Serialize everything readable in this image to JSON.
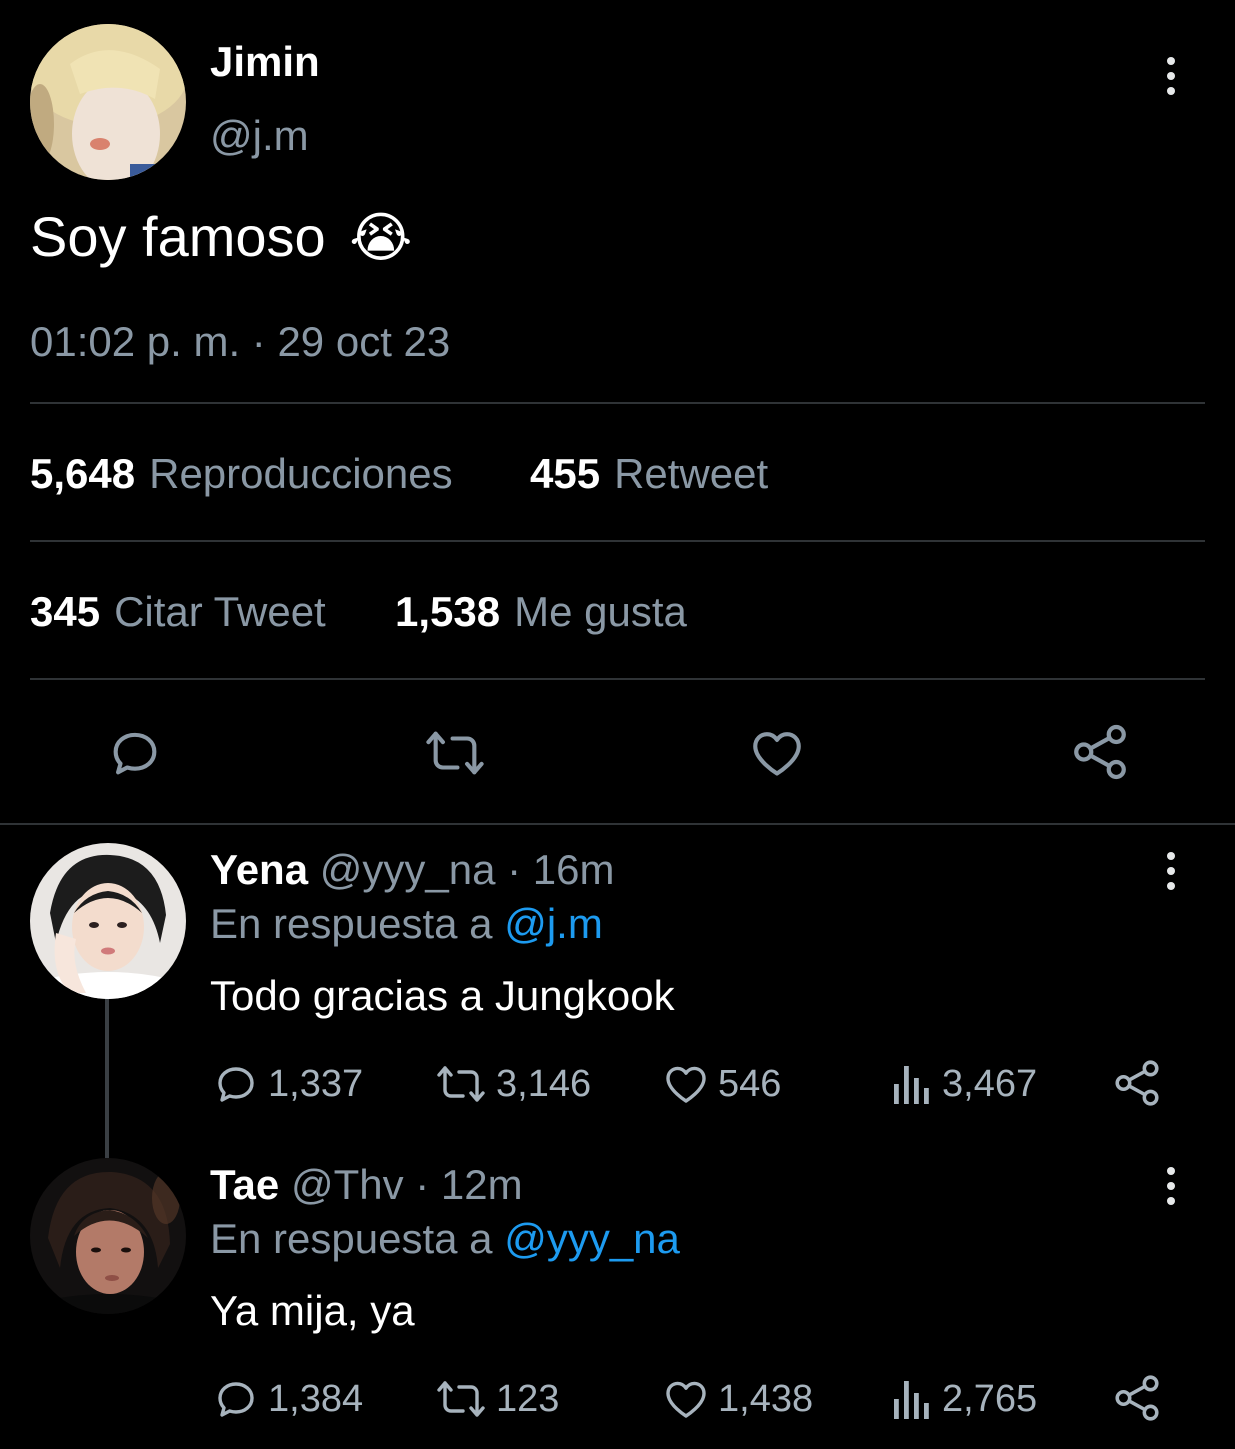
{
  "tweet": {
    "author_name": "Jimin",
    "author_handle": "@j.m",
    "text": "Soy famoso",
    "emoji": "😭",
    "timestamp": "01:02 p. m. · 29 oct 23",
    "stats": {
      "views_count": "5,648",
      "views_label": "Reproducciones",
      "retweets_count": "455",
      "retweets_label": "Retweet",
      "quotes_count": "345",
      "quotes_label": "Citar Tweet",
      "likes_count": "1,538",
      "likes_label": "Me gusta"
    }
  },
  "replies": [
    {
      "name": "Yena",
      "handle": "@yyy_na",
      "time": "· 16m",
      "reply_prefix": "En respuesta a",
      "reply_to": "@j.m",
      "text": "Todo gracias a Jungkook",
      "replies": "1,337",
      "retweets": "3,146",
      "likes": "546",
      "views": "3,467"
    },
    {
      "name": "Tae",
      "handle": "@Thv",
      "time": "· 12m",
      "reply_prefix": "En respuesta a",
      "reply_to": "@yyy_na",
      "text": "Ya mija, ya",
      "replies": "1,384",
      "retweets": "123",
      "likes": "1,438",
      "views": "2,765"
    }
  ],
  "colors": {
    "background": "#000000",
    "text": "#e7e9ea",
    "muted": "#8a98a5",
    "link": "#1d9bf0",
    "divider": "#2f3336"
  },
  "icons": [
    "more-vertical-icon",
    "reply-icon",
    "retweet-icon",
    "like-icon",
    "share-icon",
    "views-icon"
  ]
}
